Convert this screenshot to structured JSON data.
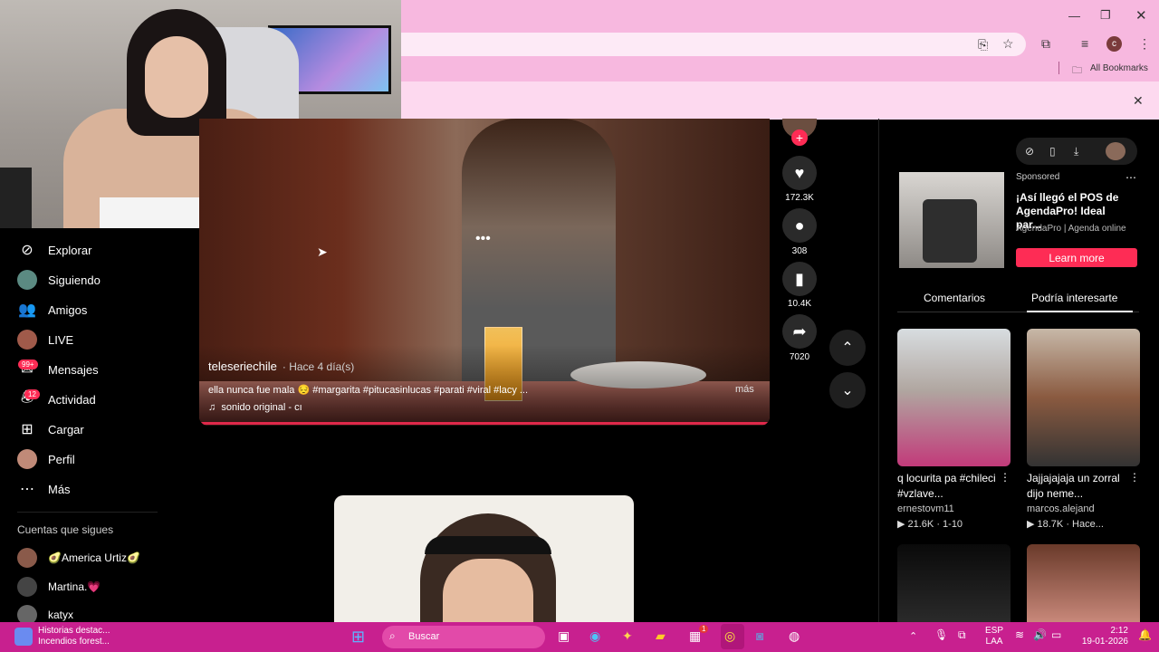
{
  "browser": {
    "bookmarks_label": "All Bookmarks",
    "profile_letter": "c"
  },
  "sidebar": {
    "items": [
      {
        "label": "Explorar",
        "icon": "compass-icon"
      },
      {
        "label": "Siguiendo",
        "icon": "avatar"
      },
      {
        "label": "Amigos",
        "icon": "friends-icon"
      },
      {
        "label": "LIVE",
        "icon": "avatar"
      },
      {
        "label": "Mensajes",
        "icon": "message-icon",
        "badge": "99+"
      },
      {
        "label": "Actividad",
        "icon": "activity-icon",
        "badge": "12"
      },
      {
        "label": "Cargar",
        "icon": "upload-icon"
      },
      {
        "label": "Perfil",
        "icon": "avatar"
      },
      {
        "label": "Más",
        "icon": "more-icon"
      }
    ],
    "following_title": "Cuentas que sigues",
    "following": [
      {
        "name": "🥑America Urtiz🥑"
      },
      {
        "name": "Martina.💗"
      },
      {
        "name": "katyx"
      }
    ]
  },
  "video": {
    "author": "teleseriechile",
    "ago": "· Hace 4 día(s)",
    "description": "ella nunca fue mala 😔 #margarita #pitucasinlucas #parati #viral #lacy ...",
    "more": "más",
    "sound": "sonido original - cı"
  },
  "actions": {
    "likes": "172.3K",
    "comments": "308",
    "saves": "10.4K",
    "shares": "7020"
  },
  "ad": {
    "sponsored": "Sponsored",
    "title": "¡Así llegó el POS de AgendaPro! Ideal par...",
    "subtitle": "AgendaPro | Agenda online",
    "cta": "Learn more"
  },
  "tabs": {
    "comments": "Comentarios",
    "interest": "Podría interesarte"
  },
  "recommended": [
    {
      "title": "q locurita pa #chileci #vzlave...",
      "author": "ernestovm11",
      "meta": "▶ 21.6K · 1-10"
    },
    {
      "title": "Jajjajajaja un zorral dijo neme...",
      "author": "marcos.alejand",
      "meta": "▶ 18.7K · Hace..."
    }
  ],
  "taskbar": {
    "news_line1": "Historias destac...",
    "news_line2": "Incendios forest...",
    "search": "Buscar",
    "lang1": "ESP",
    "lang2": "LAA",
    "time": "2:12",
    "date": "19-01-2026",
    "store_badge": "1"
  }
}
